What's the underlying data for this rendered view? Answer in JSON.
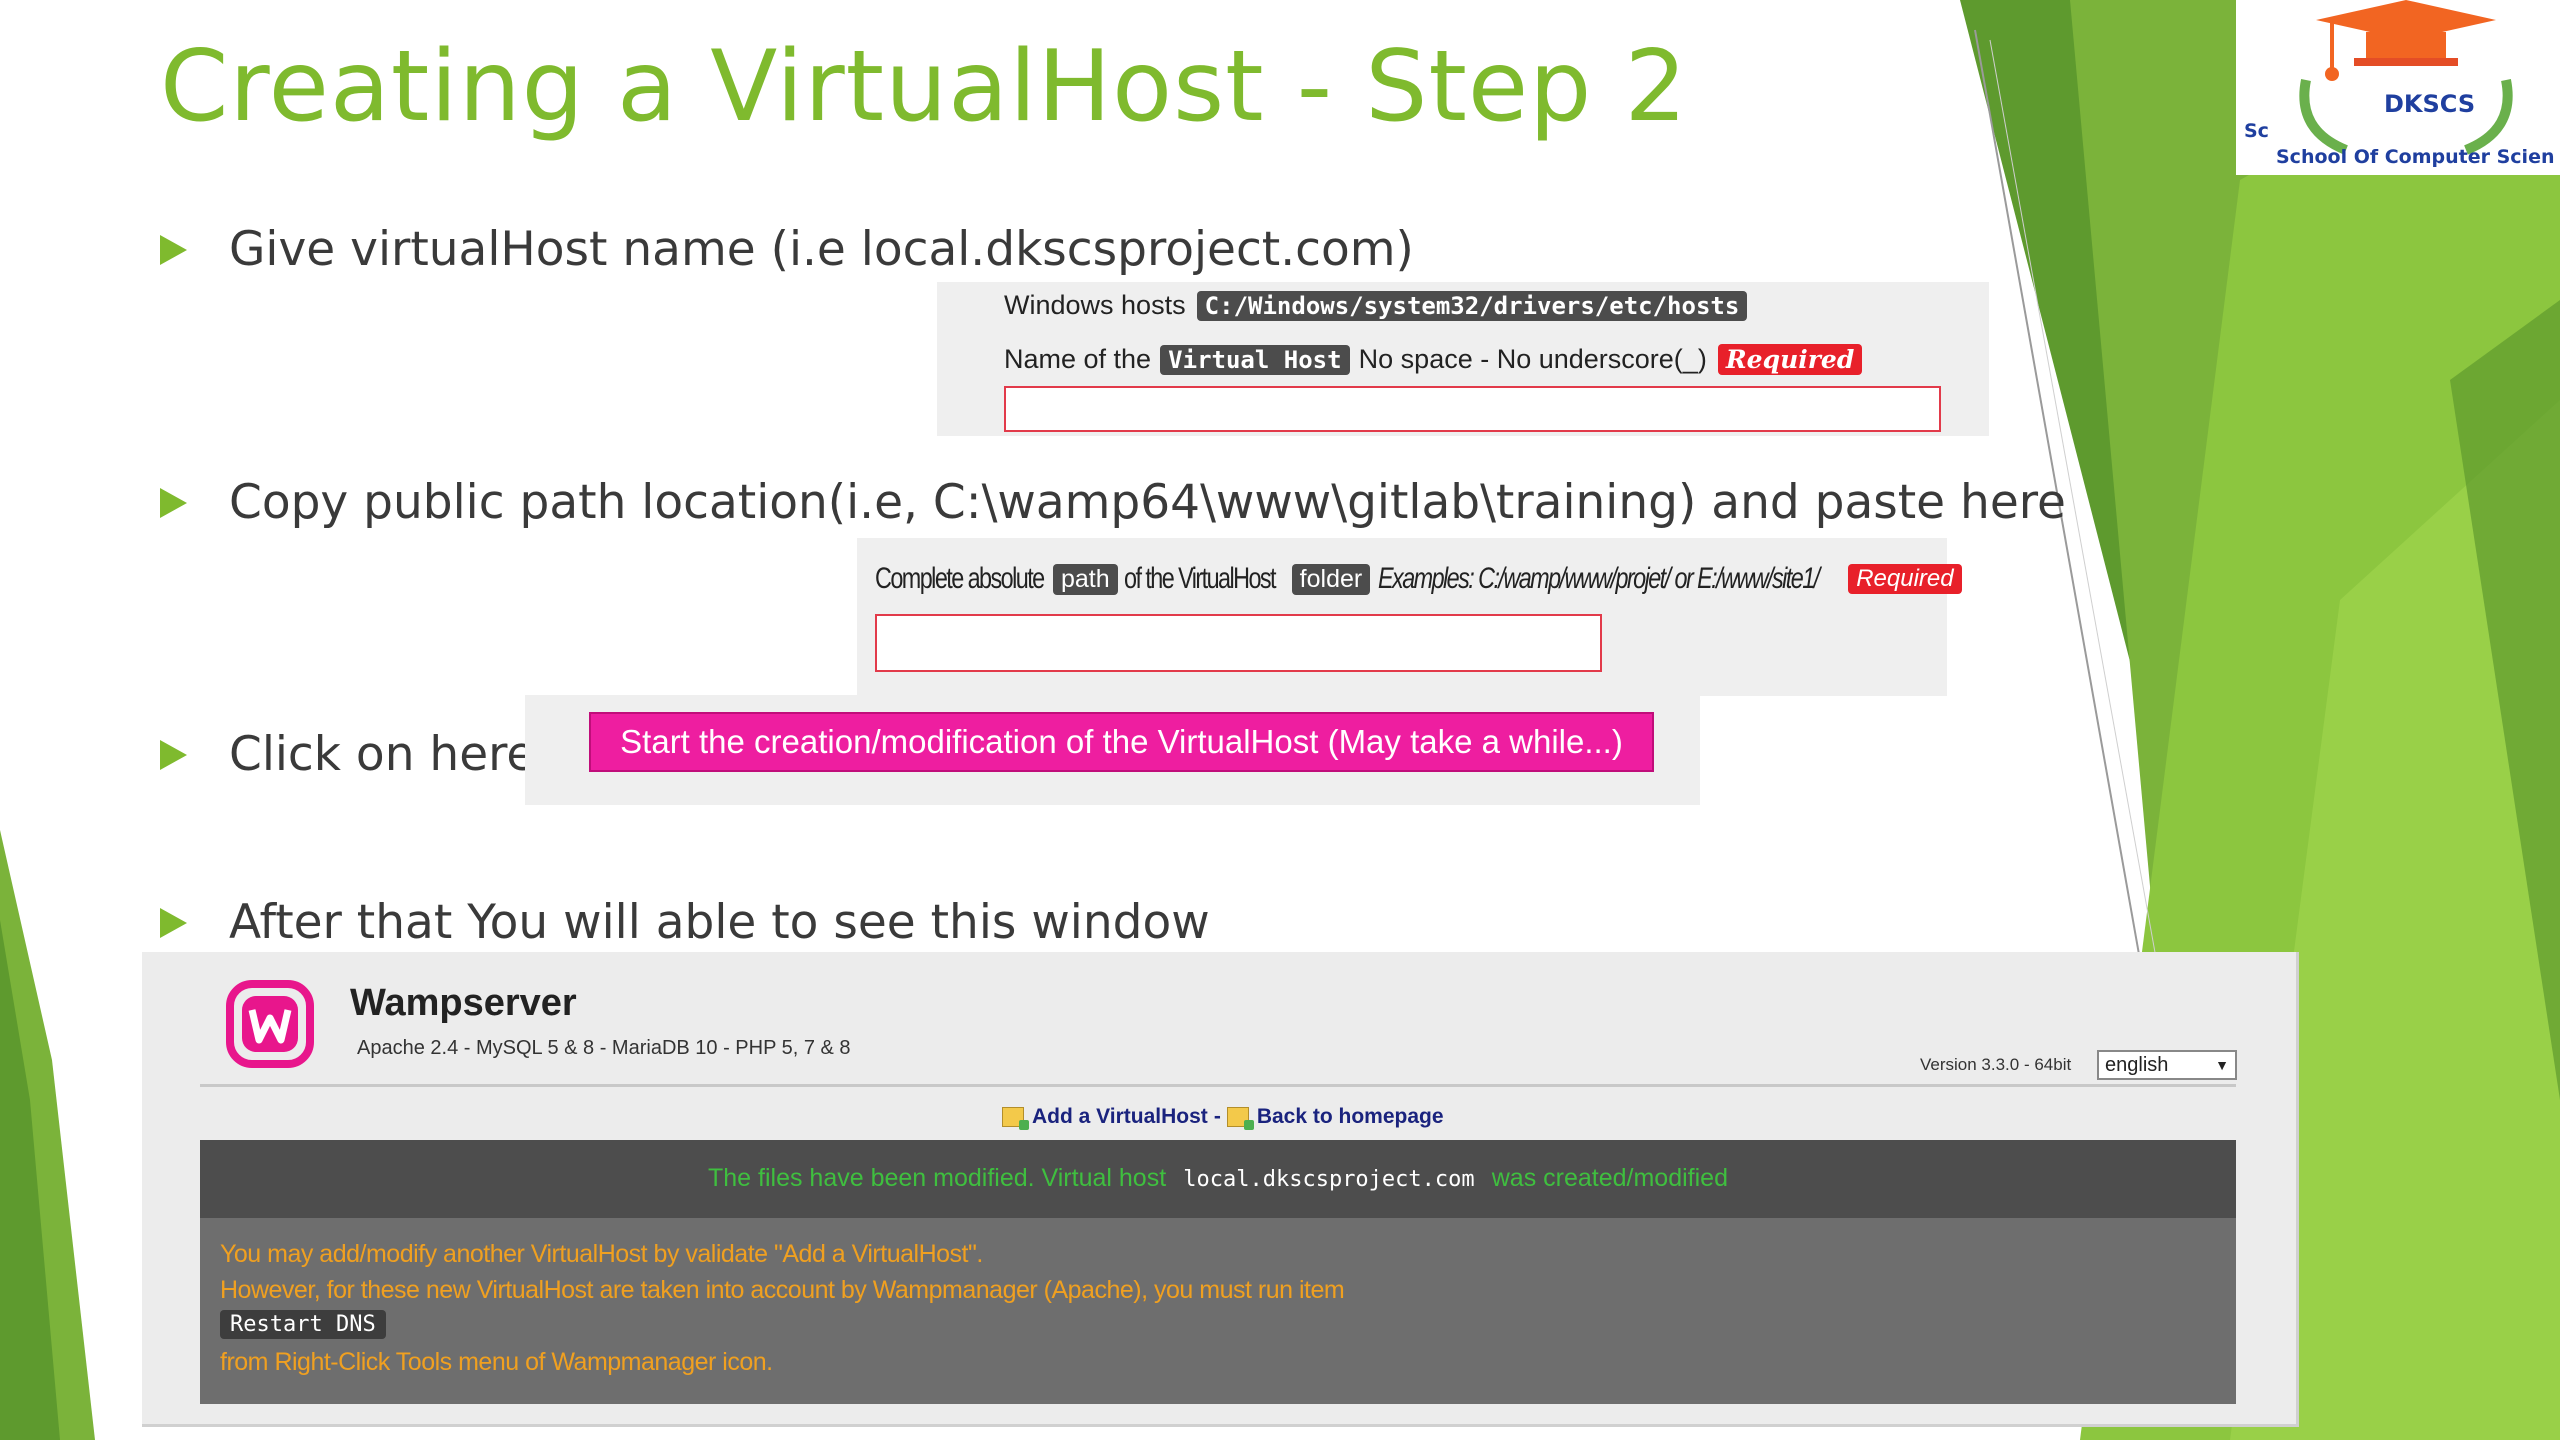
{
  "slide": {
    "title": "Creating a VirtualHost - Step 2",
    "bullets": [
      "Give virtualHost name (i.e local.dkscsproject.com)",
      "Copy public path location(i.e, C:\\wamp64\\www\\gitlab\\training) and paste here",
      "Click on here",
      "After that You will able to see this window"
    ]
  },
  "logo": {
    "name": "DKSCS",
    "subtitle": "School Of Computer Scien",
    "side_text": "Sc"
  },
  "hosts_panel": {
    "windows_hosts_label": "Windows hosts",
    "hosts_path": "C:/Windows/system32/drivers/etc/hosts",
    "name_prefix": "Name of the",
    "name_pill": "Virtual Host",
    "name_suffix": "No space - No underscore(_)",
    "required": "Required",
    "input_value": ""
  },
  "path_panel": {
    "prefix": "Complete absolute",
    "path_pill": "path",
    "middle": "of the VirtualHost",
    "folder_pill": "folder",
    "examples": "Examples: C:/wamp/www/projet/ or E:/www/site1/",
    "required": "Required",
    "input_value": ""
  },
  "start_button": {
    "label": "Start the creation/modification of the VirtualHost (May take a while...)"
  },
  "wampserver": {
    "title": "Wampserver",
    "versions": "Apache 2.4  -  MySQL 5 & 8  -  MariaDB 10  -  PHP 5, 7 & 8",
    "version_label": "Version 3.3.0 - 64bit",
    "language": "english",
    "add_link": "Add a VirtualHost",
    "separator": "-",
    "back_link": "Back to homepage",
    "msg_prefix": "The files have been modified. Virtual host",
    "msg_host": "local.dkscsproject.com",
    "msg_suffix": "was created/modified",
    "note_line1": "You may add/modify another VirtualHost by validate \"Add a VirtualHost\".",
    "note_line2": "However, for these new VirtualHost are taken into account by Wampmanager (Apache), you must run item",
    "note_cmd": "Restart DNS",
    "note_line3": "from Right-Click Tools menu of Wampmanager icon."
  },
  "colors": {
    "accent_green": "#7fba2e",
    "button_pink": "#ee1ea0",
    "required_red": "#e8202a",
    "success_green": "#3fbf3f",
    "note_orange": "#f0a020"
  }
}
